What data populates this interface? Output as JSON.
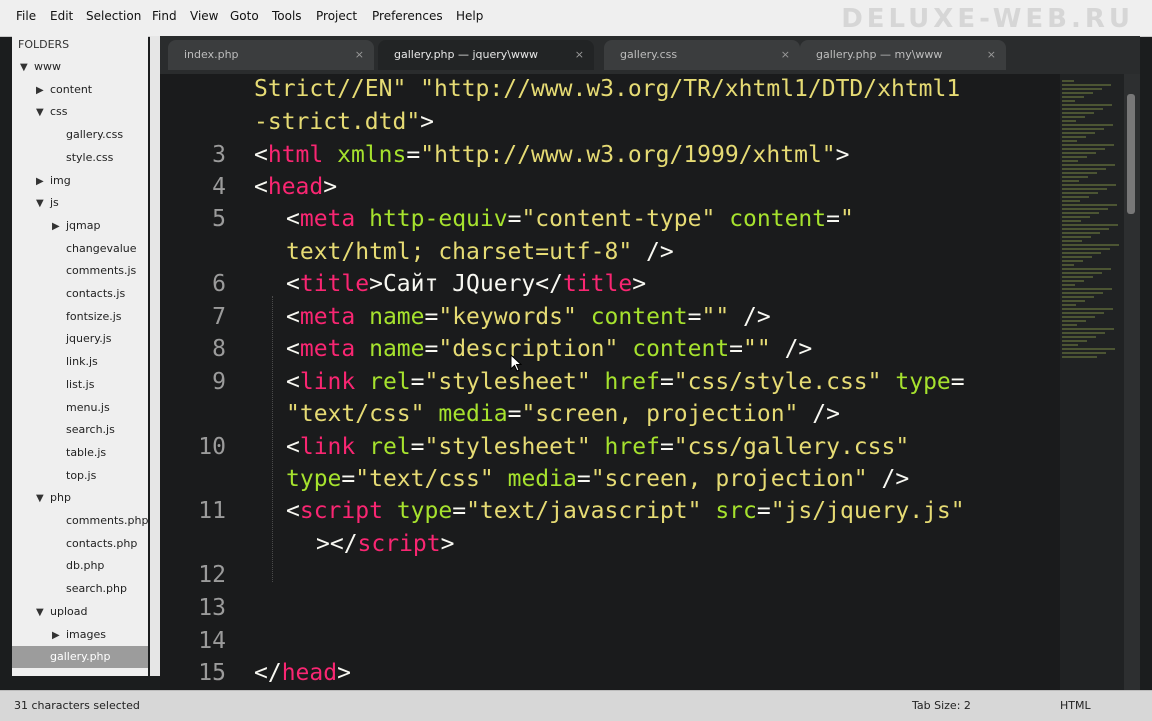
{
  "watermark": "DELUXE-WEB.RU",
  "menu": [
    "File",
    "Edit",
    "Selection",
    "Find",
    "View",
    "Goto",
    "Tools",
    "Project",
    "Preferences",
    "Help"
  ],
  "sidebar": {
    "title": "FOLDERS",
    "items": [
      {
        "label": "www",
        "arrow": "▼",
        "depth": 0
      },
      {
        "label": "content",
        "arrow": "▶",
        "depth": 1
      },
      {
        "label": "css",
        "arrow": "▼",
        "depth": 1
      },
      {
        "label": "gallery.css",
        "arrow": "",
        "depth": 2
      },
      {
        "label": "style.css",
        "arrow": "",
        "depth": 2
      },
      {
        "label": "img",
        "arrow": "▶",
        "depth": 1
      },
      {
        "label": "js",
        "arrow": "▼",
        "depth": 1
      },
      {
        "label": "jqmap",
        "arrow": "▶",
        "depth": 2
      },
      {
        "label": "changevalue",
        "arrow": "",
        "depth": 2
      },
      {
        "label": "comments.js",
        "arrow": "",
        "depth": 2
      },
      {
        "label": "contacts.js",
        "arrow": "",
        "depth": 2
      },
      {
        "label": "fontsize.js",
        "arrow": "",
        "depth": 2
      },
      {
        "label": "jquery.js",
        "arrow": "",
        "depth": 2
      },
      {
        "label": "link.js",
        "arrow": "",
        "depth": 2
      },
      {
        "label": "list.js",
        "arrow": "",
        "depth": 2
      },
      {
        "label": "menu.js",
        "arrow": "",
        "depth": 2
      },
      {
        "label": "search.js",
        "arrow": "",
        "depth": 2
      },
      {
        "label": "table.js",
        "arrow": "",
        "depth": 2
      },
      {
        "label": "top.js",
        "arrow": "",
        "depth": 2
      },
      {
        "label": "php",
        "arrow": "▼",
        "depth": 1
      },
      {
        "label": "comments.php",
        "arrow": "",
        "depth": 2
      },
      {
        "label": "contacts.php",
        "arrow": "",
        "depth": 2
      },
      {
        "label": "db.php",
        "arrow": "",
        "depth": 2
      },
      {
        "label": "search.php",
        "arrow": "",
        "depth": 2
      },
      {
        "label": "upload",
        "arrow": "▼",
        "depth": 1
      },
      {
        "label": "images",
        "arrow": "▶",
        "depth": 2
      },
      {
        "label": "gallery.php",
        "arrow": "",
        "depth": 1
      }
    ]
  },
  "tabs": [
    {
      "label": "index.php",
      "close": "×"
    },
    {
      "label": "gallery.php — jquery\\www",
      "close": "×"
    },
    {
      "label": "gallery.css",
      "close": "×"
    },
    {
      "label": "gallery.php — my\\www",
      "close": "×"
    }
  ],
  "line_numbers": [
    "3",
    "4",
    "5",
    "6",
    "7",
    "8",
    "9",
    "10",
    "11",
    "12",
    "13",
    "14",
    "15"
  ],
  "status": {
    "selection": "31 characters selected",
    "tab_size": "Tab Size: 2",
    "syntax": "HTML"
  },
  "colors": {
    "background": "#1a1b1c",
    "tag": "#f92672",
    "attribute": "#a6e22e",
    "string": "#e6db74"
  }
}
